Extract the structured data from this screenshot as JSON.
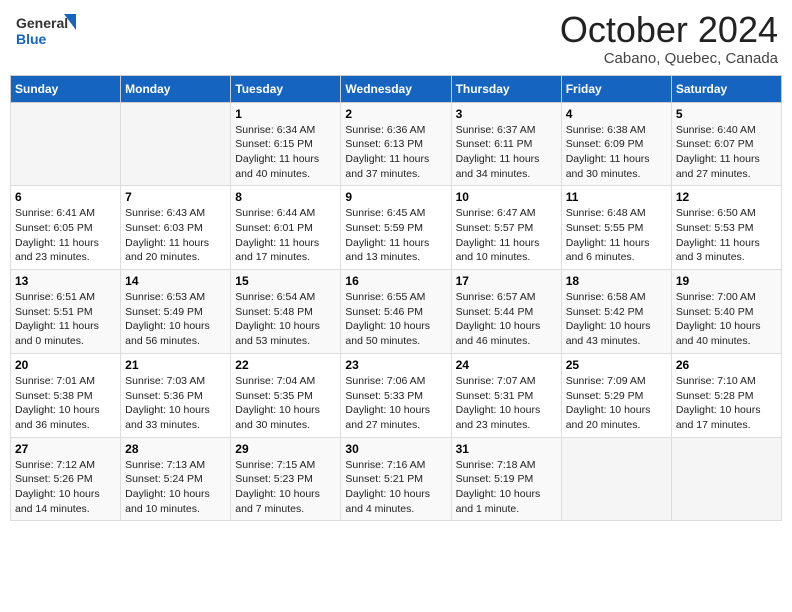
{
  "header": {
    "logo_general": "General",
    "logo_blue": "Blue",
    "month_title": "October 2024",
    "location": "Cabano, Quebec, Canada"
  },
  "days_of_week": [
    "Sunday",
    "Monday",
    "Tuesday",
    "Wednesday",
    "Thursday",
    "Friday",
    "Saturday"
  ],
  "weeks": [
    [
      {
        "day": "",
        "info": ""
      },
      {
        "day": "",
        "info": ""
      },
      {
        "day": "1",
        "info": "Sunrise: 6:34 AM\nSunset: 6:15 PM\nDaylight: 11 hours and 40 minutes."
      },
      {
        "day": "2",
        "info": "Sunrise: 6:36 AM\nSunset: 6:13 PM\nDaylight: 11 hours and 37 minutes."
      },
      {
        "day": "3",
        "info": "Sunrise: 6:37 AM\nSunset: 6:11 PM\nDaylight: 11 hours and 34 minutes."
      },
      {
        "day": "4",
        "info": "Sunrise: 6:38 AM\nSunset: 6:09 PM\nDaylight: 11 hours and 30 minutes."
      },
      {
        "day": "5",
        "info": "Sunrise: 6:40 AM\nSunset: 6:07 PM\nDaylight: 11 hours and 27 minutes."
      }
    ],
    [
      {
        "day": "6",
        "info": "Sunrise: 6:41 AM\nSunset: 6:05 PM\nDaylight: 11 hours and 23 minutes."
      },
      {
        "day": "7",
        "info": "Sunrise: 6:43 AM\nSunset: 6:03 PM\nDaylight: 11 hours and 20 minutes."
      },
      {
        "day": "8",
        "info": "Sunrise: 6:44 AM\nSunset: 6:01 PM\nDaylight: 11 hours and 17 minutes."
      },
      {
        "day": "9",
        "info": "Sunrise: 6:45 AM\nSunset: 5:59 PM\nDaylight: 11 hours and 13 minutes."
      },
      {
        "day": "10",
        "info": "Sunrise: 6:47 AM\nSunset: 5:57 PM\nDaylight: 11 hours and 10 minutes."
      },
      {
        "day": "11",
        "info": "Sunrise: 6:48 AM\nSunset: 5:55 PM\nDaylight: 11 hours and 6 minutes."
      },
      {
        "day": "12",
        "info": "Sunrise: 6:50 AM\nSunset: 5:53 PM\nDaylight: 11 hours and 3 minutes."
      }
    ],
    [
      {
        "day": "13",
        "info": "Sunrise: 6:51 AM\nSunset: 5:51 PM\nDaylight: 11 hours and 0 minutes."
      },
      {
        "day": "14",
        "info": "Sunrise: 6:53 AM\nSunset: 5:49 PM\nDaylight: 10 hours and 56 minutes."
      },
      {
        "day": "15",
        "info": "Sunrise: 6:54 AM\nSunset: 5:48 PM\nDaylight: 10 hours and 53 minutes."
      },
      {
        "day": "16",
        "info": "Sunrise: 6:55 AM\nSunset: 5:46 PM\nDaylight: 10 hours and 50 minutes."
      },
      {
        "day": "17",
        "info": "Sunrise: 6:57 AM\nSunset: 5:44 PM\nDaylight: 10 hours and 46 minutes."
      },
      {
        "day": "18",
        "info": "Sunrise: 6:58 AM\nSunset: 5:42 PM\nDaylight: 10 hours and 43 minutes."
      },
      {
        "day": "19",
        "info": "Sunrise: 7:00 AM\nSunset: 5:40 PM\nDaylight: 10 hours and 40 minutes."
      }
    ],
    [
      {
        "day": "20",
        "info": "Sunrise: 7:01 AM\nSunset: 5:38 PM\nDaylight: 10 hours and 36 minutes."
      },
      {
        "day": "21",
        "info": "Sunrise: 7:03 AM\nSunset: 5:36 PM\nDaylight: 10 hours and 33 minutes."
      },
      {
        "day": "22",
        "info": "Sunrise: 7:04 AM\nSunset: 5:35 PM\nDaylight: 10 hours and 30 minutes."
      },
      {
        "day": "23",
        "info": "Sunrise: 7:06 AM\nSunset: 5:33 PM\nDaylight: 10 hours and 27 minutes."
      },
      {
        "day": "24",
        "info": "Sunrise: 7:07 AM\nSunset: 5:31 PM\nDaylight: 10 hours and 23 minutes."
      },
      {
        "day": "25",
        "info": "Sunrise: 7:09 AM\nSunset: 5:29 PM\nDaylight: 10 hours and 20 minutes."
      },
      {
        "day": "26",
        "info": "Sunrise: 7:10 AM\nSunset: 5:28 PM\nDaylight: 10 hours and 17 minutes."
      }
    ],
    [
      {
        "day": "27",
        "info": "Sunrise: 7:12 AM\nSunset: 5:26 PM\nDaylight: 10 hours and 14 minutes."
      },
      {
        "day": "28",
        "info": "Sunrise: 7:13 AM\nSunset: 5:24 PM\nDaylight: 10 hours and 10 minutes."
      },
      {
        "day": "29",
        "info": "Sunrise: 7:15 AM\nSunset: 5:23 PM\nDaylight: 10 hours and 7 minutes."
      },
      {
        "day": "30",
        "info": "Sunrise: 7:16 AM\nSunset: 5:21 PM\nDaylight: 10 hours and 4 minutes."
      },
      {
        "day": "31",
        "info": "Sunrise: 7:18 AM\nSunset: 5:19 PM\nDaylight: 10 hours and 1 minute."
      },
      {
        "day": "",
        "info": ""
      },
      {
        "day": "",
        "info": ""
      }
    ]
  ]
}
